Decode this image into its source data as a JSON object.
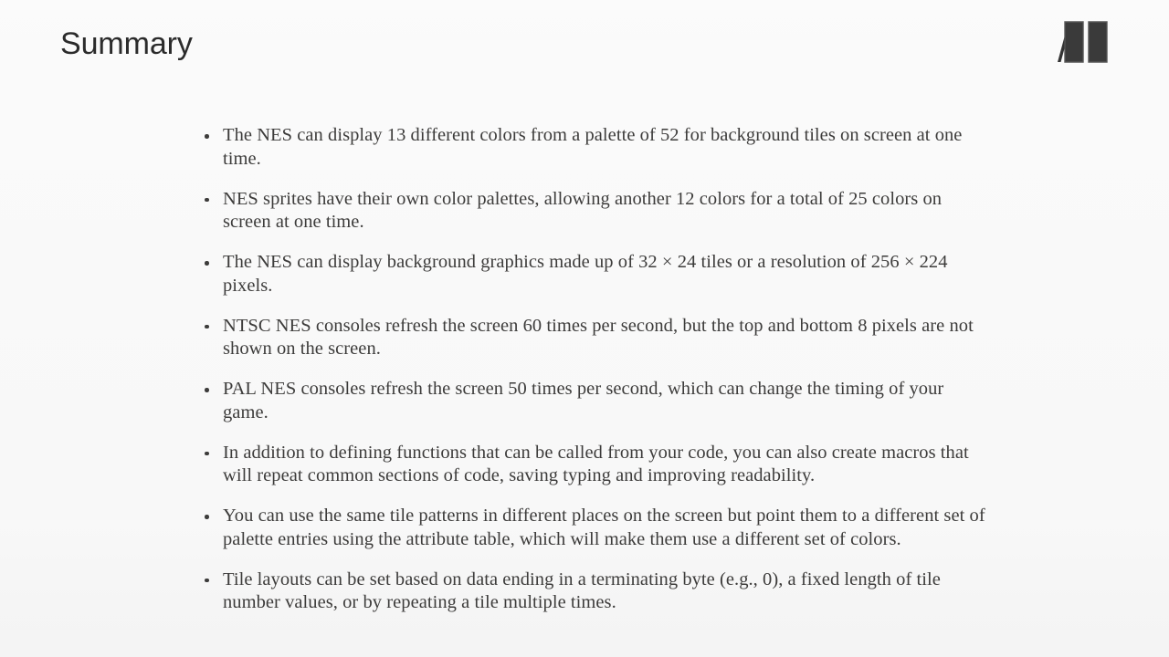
{
  "slide": {
    "title": "Summary",
    "logo": {
      "icon_name": "logo-mark",
      "color": "#333333"
    },
    "bullets": [
      "The NES can display 13 different colors from a palette of 52 for background tiles on screen at one time.",
      "NES sprites have their own color palettes, allowing another 12 colors for a total of 25 colors on screen at one time.",
      "The NES can display background graphics made up of 32 × 24 tiles or a resolution of 256 × 224 pixels.",
      "NTSC NES consoles refresh the screen 60 times per second, but the top and bottom 8 pixels are not shown on the screen.",
      "PAL NES consoles refresh the screen 50 times per second, which can change the timing of your game.",
      "In addition to defining functions that can be called from your code, you can also create macros that will repeat common sections of code, saving typing and improving readability.",
      "You can use the same tile patterns in different places on the screen but point them to a different set of palette entries using the attribute table, which will make them use a different set of colors.",
      "Tile layouts can be set based on data ending in a terminating byte (e.g., 0), a fixed length of tile number values, or by repeating a tile multiple times."
    ]
  }
}
